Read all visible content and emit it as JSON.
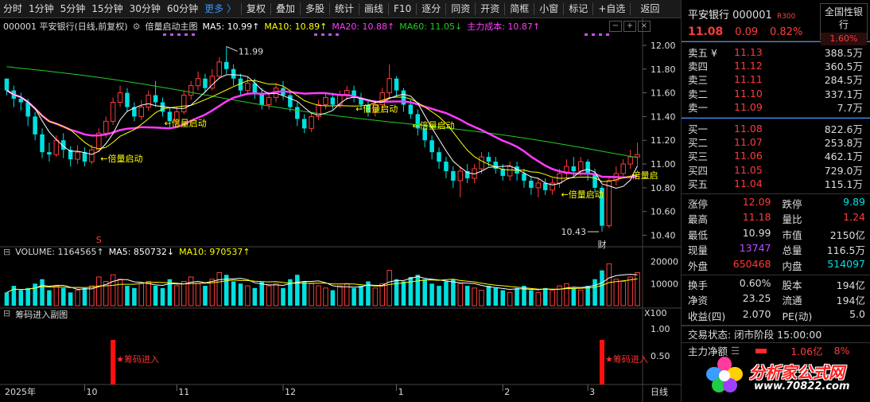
{
  "toolbar": {
    "periods": [
      "分时",
      "1分钟",
      "5分钟",
      "15分钟",
      "30分钟",
      "60分钟"
    ],
    "more": "更多 〉",
    "tools": [
      "复权",
      "叠加",
      "多股",
      "统计",
      "画线",
      "F10",
      "逐分",
      "同资",
      "开资",
      "简框",
      "小窗",
      "标记",
      "+自选",
      "返回"
    ]
  },
  "info": {
    "stock": "000001 平安银行(日线,前复权)",
    "indicator": "倍量启动主图",
    "ma5": "MA5: 10.99↑",
    "ma10": "MA10: 10.89↑",
    "ma20": "MA20: 10.88↑",
    "ma60": "MA60: 11.05↓",
    "cost": "主力成本: 10.87↑"
  },
  "volume_info": {
    "volume": "VOLUME: 1164565↑",
    "ma5": "MA5: 850732↓",
    "ma10": "MA10: 970537↑"
  },
  "sub_title": "筹码进入副图",
  "signals": {
    "chip": "★筹码进入",
    "double": "←倍量启动",
    "double_cut": "倍量启"
  },
  "annotations": {
    "high": "11.99",
    "low": "10.43",
    "cai": "财",
    "s_mark": "S"
  },
  "axis": {
    "price_ticks": [
      "12.00",
      "11.80",
      "11.60",
      "11.40",
      "11.20",
      "11.00",
      "10.80",
      "10.60",
      "10.40"
    ],
    "volume_ticks": [
      "20000",
      "10000",
      "X100"
    ],
    "sub_ticks": [
      "1.00",
      "0.50"
    ],
    "date_labels": [
      "2025年",
      "10",
      "11",
      "12",
      "1",
      "2",
      "3"
    ],
    "period": "日线"
  },
  "colors": {
    "up": "#ff3b3b",
    "down": "#00e0e0",
    "ma5": "#ffffff",
    "ma10": "#ffff00",
    "ma20": "#ff3cff",
    "ma60": "#22cc22",
    "cost": "#ff3cff"
  },
  "chart_data": {
    "type": "candlestick",
    "price_range": [
      10.35,
      12.08
    ],
    "candles": [
      [
        11.72,
        11.62,
        11.7,
        11.58
      ],
      [
        11.62,
        11.55,
        11.66,
        11.48
      ],
      [
        11.55,
        11.52,
        11.6,
        11.45
      ],
      [
        11.52,
        11.4,
        11.55,
        11.32
      ],
      [
        11.4,
        11.25,
        11.44,
        11.2
      ],
      [
        11.25,
        11.1,
        11.3,
        11.05
      ],
      [
        11.1,
        11.08,
        11.18,
        11.02
      ],
      [
        11.08,
        11.2,
        11.24,
        11.06
      ],
      [
        11.2,
        11.12,
        11.26,
        11.05
      ],
      [
        11.12,
        11.04,
        11.15,
        10.98
      ],
      [
        11.04,
        11.1,
        11.16,
        11.0
      ],
      [
        11.1,
        11.02,
        11.14,
        10.98
      ],
      [
        11.02,
        11.12,
        11.16,
        11.0
      ],
      [
        11.12,
        11.26,
        11.3,
        11.1
      ],
      [
        11.26,
        11.36,
        11.4,
        11.22
      ],
      [
        11.36,
        11.52,
        11.56,
        11.33
      ],
      [
        11.52,
        11.6,
        11.66,
        11.48
      ],
      [
        11.6,
        11.48,
        11.64,
        11.44
      ],
      [
        11.48,
        11.4,
        11.52,
        11.36
      ],
      [
        11.4,
        11.48,
        11.54,
        11.37
      ],
      [
        11.48,
        11.58,
        11.62,
        11.45
      ],
      [
        11.58,
        11.52,
        11.7,
        11.48
      ],
      [
        11.52,
        11.44,
        11.56,
        11.4
      ],
      [
        11.44,
        11.36,
        11.48,
        11.3
      ],
      [
        11.36,
        11.44,
        11.48,
        11.32
      ],
      [
        11.44,
        11.58,
        11.62,
        11.42
      ],
      [
        11.58,
        11.66,
        11.7,
        11.54
      ],
      [
        11.66,
        11.72,
        11.78,
        11.62
      ],
      [
        11.72,
        11.64,
        11.76,
        11.6
      ],
      [
        11.64,
        11.74,
        11.8,
        11.62
      ],
      [
        11.74,
        11.86,
        11.9,
        11.72
      ],
      [
        11.86,
        11.8,
        11.99,
        11.76
      ],
      [
        11.8,
        11.72,
        11.84,
        11.66
      ],
      [
        11.72,
        11.62,
        11.76,
        11.58
      ],
      [
        11.62,
        11.68,
        11.74,
        11.58
      ],
      [
        11.68,
        11.6,
        11.72,
        11.55
      ],
      [
        11.6,
        11.5,
        11.64,
        11.46
      ],
      [
        11.5,
        11.56,
        11.6,
        11.46
      ],
      [
        11.56,
        11.64,
        11.68,
        11.52
      ],
      [
        11.64,
        11.58,
        11.7,
        11.54
      ],
      [
        11.58,
        11.48,
        11.62,
        11.44
      ],
      [
        11.48,
        11.38,
        11.52,
        11.32
      ],
      [
        11.38,
        11.3,
        11.42,
        11.26
      ],
      [
        11.3,
        11.4,
        11.44,
        11.27
      ],
      [
        11.4,
        11.5,
        11.54,
        11.37
      ],
      [
        11.5,
        11.56,
        11.6,
        11.46
      ],
      [
        11.56,
        11.5,
        11.6,
        11.46
      ],
      [
        11.5,
        11.58,
        11.62,
        11.47
      ],
      [
        11.58,
        11.62,
        11.66,
        11.54
      ],
      [
        11.62,
        11.56,
        11.66,
        11.52
      ],
      [
        11.56,
        11.5,
        11.6,
        11.46
      ],
      [
        11.5,
        11.44,
        11.54,
        11.4
      ],
      [
        11.44,
        11.5,
        11.54,
        11.4
      ],
      [
        11.5,
        11.6,
        11.64,
        11.47
      ],
      [
        11.6,
        11.72,
        11.84,
        11.56
      ],
      [
        11.72,
        11.62,
        11.74,
        11.56
      ],
      [
        11.62,
        11.5,
        11.64,
        11.44
      ],
      [
        11.5,
        11.42,
        11.54,
        11.38
      ],
      [
        11.42,
        11.3,
        11.46,
        11.24
      ],
      [
        11.3,
        11.2,
        11.34,
        11.14
      ],
      [
        11.2,
        11.1,
        11.24,
        11.04
      ],
      [
        11.1,
        11.02,
        11.14,
        10.96
      ],
      [
        11.02,
        10.94,
        11.06,
        10.88
      ],
      [
        10.94,
        10.86,
        10.98,
        10.8
      ],
      [
        10.86,
        10.94,
        10.98,
        10.72
      ],
      [
        10.94,
        10.88,
        11.0,
        10.84
      ],
      [
        10.88,
        10.96,
        11.0,
        10.84
      ],
      [
        10.96,
        11.06,
        11.1,
        10.92
      ],
      [
        11.06,
        11.02,
        11.1,
        10.98
      ],
      [
        11.02,
        10.96,
        11.06,
        10.92
      ],
      [
        10.96,
        10.9,
        11.0,
        10.86
      ],
      [
        10.9,
        10.98,
        11.02,
        10.86
      ],
      [
        10.98,
        10.92,
        11.02,
        10.86
      ],
      [
        10.92,
        10.86,
        10.96,
        10.8
      ],
      [
        10.86,
        10.8,
        10.9,
        10.74
      ],
      [
        10.8,
        10.84,
        10.88,
        10.72
      ],
      [
        10.84,
        10.78,
        10.88,
        10.74
      ],
      [
        10.78,
        10.84,
        10.88,
        10.74
      ],
      [
        10.84,
        10.92,
        10.96,
        10.8
      ],
      [
        10.92,
        10.98,
        11.04,
        10.88
      ],
      [
        10.98,
        10.94,
        11.06,
        10.9
      ],
      [
        10.94,
        11.02,
        11.06,
        10.9
      ],
      [
        11.02,
        10.92,
        11.04,
        10.86
      ],
      [
        10.92,
        10.8,
        10.96,
        10.76
      ],
      [
        10.8,
        10.48,
        10.82,
        10.43
      ],
      [
        10.48,
        10.86,
        10.9,
        10.46
      ],
      [
        10.86,
        10.92,
        10.98,
        10.82
      ],
      [
        10.92,
        11.0,
        11.04,
        10.88
      ],
      [
        11.0,
        11.06,
        11.12,
        10.96
      ],
      [
        11.06,
        11.08,
        11.18,
        10.99
      ]
    ],
    "volume": [
      6,
      9,
      7,
      8,
      10,
      12,
      7,
      9,
      8,
      6,
      7,
      8,
      9,
      13,
      11,
      14,
      12,
      9,
      8,
      10,
      11,
      9,
      8,
      12,
      9,
      11,
      13,
      10,
      9,
      12,
      15,
      14,
      11,
      10,
      9,
      8,
      11,
      9,
      10,
      8,
      12,
      14,
      11,
      10,
      9,
      8,
      7,
      9,
      10,
      8,
      9,
      11,
      8,
      10,
      16,
      12,
      11,
      13,
      14,
      12,
      10,
      9,
      11,
      12,
      10,
      9,
      8,
      7,
      9,
      8,
      7,
      6,
      8,
      9,
      7,
      6,
      8,
      7,
      9,
      10,
      8,
      7,
      9,
      12,
      16,
      19,
      12,
      11,
      13,
      15
    ],
    "chip_signals": [
      15,
      84
    ],
    "double_signals": [
      13,
      22,
      49,
      57,
      78,
      88
    ]
  },
  "quote": {
    "name": "平安银行",
    "code": "000001",
    "badge": "R300",
    "price": "11.08",
    "change": "0.09",
    "pct": "0.82%",
    "sector": "全国性银行",
    "sector_pct": "1.60%",
    "asks": [
      {
        "label": "卖五 ¥",
        "price": "11.13",
        "vol": "388.5万"
      },
      {
        "label": "卖四",
        "price": "11.12",
        "vol": "360.5万"
      },
      {
        "label": "卖三",
        "price": "11.11",
        "vol": "284.5万"
      },
      {
        "label": "卖二",
        "price": "11.10",
        "vol": "337.1万"
      },
      {
        "label": "卖一",
        "price": "11.09",
        "vol": "7.7万"
      }
    ],
    "bids": [
      {
        "label": "买一",
        "price": "11.08",
        "vol": "822.6万"
      },
      {
        "label": "买二",
        "price": "11.07",
        "vol": "253.8万"
      },
      {
        "label": "买三",
        "price": "11.06",
        "vol": "462.1万"
      },
      {
        "label": "买四",
        "price": "11.05",
        "vol": "729.0万"
      },
      {
        "label": "买五",
        "price": "11.04",
        "vol": "115.1万"
      }
    ],
    "stats1": [
      [
        {
          "l": "涨停",
          "v": "12.09",
          "c": "red"
        },
        {
          "l": "跌停",
          "v": "9.89",
          "c": "green"
        }
      ],
      [
        {
          "l": "最高",
          "v": "11.18",
          "c": "red"
        },
        {
          "l": "量比",
          "v": "1.24",
          "c": "red"
        }
      ],
      [
        {
          "l": "最低",
          "v": "10.99",
          "c": "white"
        },
        {
          "l": "市值",
          "v": "2150亿",
          "c": "white"
        }
      ],
      [
        {
          "l": "现量",
          "v": "13747",
          "c": "purple"
        },
        {
          "l": "总量",
          "v": "116.5万",
          "c": "white"
        }
      ],
      [
        {
          "l": "外盘",
          "v": "650468",
          "c": "red"
        },
        {
          "l": "内盘",
          "v": "514097",
          "c": "green"
        }
      ]
    ],
    "stats2": [
      [
        {
          "l": "换手",
          "v": "0.60%",
          "c": "white"
        },
        {
          "l": "股本",
          "v": "194亿",
          "c": "white"
        }
      ],
      [
        {
          "l": "净资",
          "v": "23.25",
          "c": "white"
        },
        {
          "l": "流通",
          "v": "194亿",
          "c": "white"
        }
      ],
      [
        {
          "l": "收益(四)",
          "v": "2.070",
          "c": "white"
        },
        {
          "l": "PE(动)",
          "v": "5.0",
          "c": "white"
        }
      ]
    ],
    "trade_status": "交易状态: 闭市阶段 15:00:00",
    "flow_label": "主力净额",
    "flow_value": "1.06亿",
    "flow_pct": "8%"
  },
  "watermark": {
    "text1": "分析家公式网",
    "text2": "www.70822.com"
  }
}
